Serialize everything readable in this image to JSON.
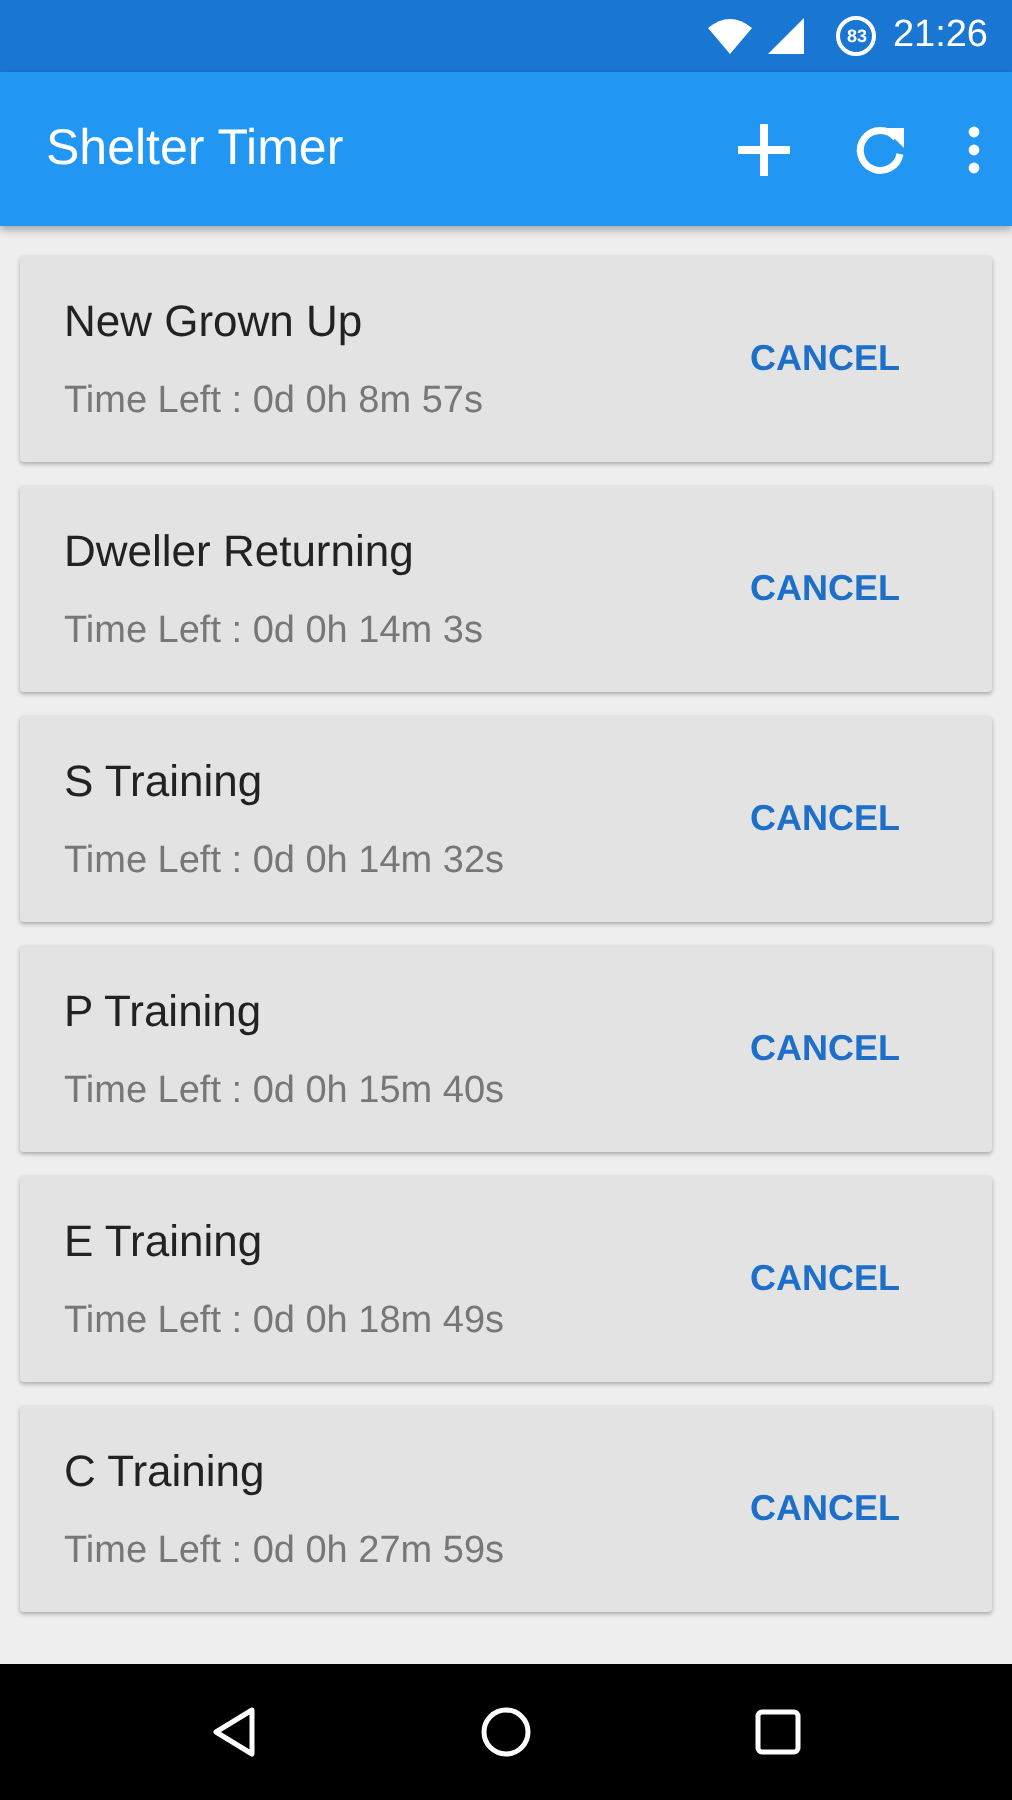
{
  "status_bar": {
    "battery": "83",
    "time": "21:26"
  },
  "app_bar": {
    "title": "Shelter Timer"
  },
  "timers": [
    {
      "name": "New Grown Up",
      "time_left": "Time Left : 0d 0h 8m 57s",
      "action": "CANCEL"
    },
    {
      "name": "Dweller Returning",
      "time_left": "Time Left : 0d 0h 14m 3s",
      "action": "CANCEL"
    },
    {
      "name": "S Training",
      "time_left": "Time Left : 0d 0h 14m 32s",
      "action": "CANCEL"
    },
    {
      "name": "P Training",
      "time_left": "Time Left : 0d 0h 15m 40s",
      "action": "CANCEL"
    },
    {
      "name": "E Training",
      "time_left": "Time Left : 0d 0h 18m 49s",
      "action": "CANCEL"
    },
    {
      "name": "C Training",
      "time_left": "Time Left : 0d 0h 27m 59s",
      "action": "CANCEL"
    }
  ]
}
